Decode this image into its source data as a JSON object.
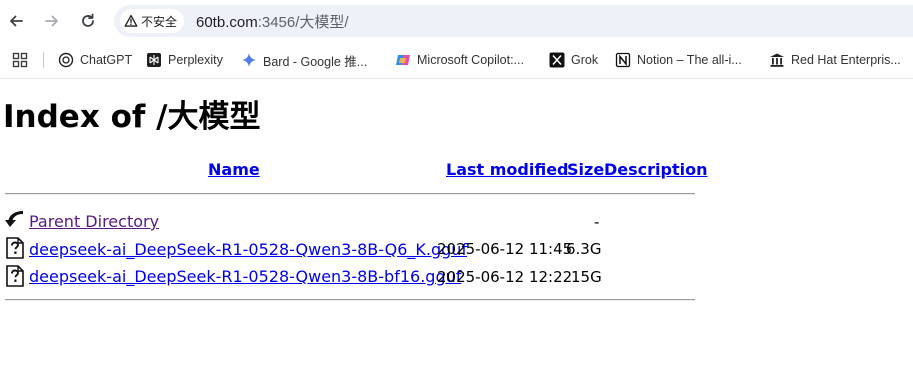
{
  "browser": {
    "security_chip": "不安全",
    "url_host": "60tb.com",
    "url_path": ":3456/大模型/"
  },
  "bookmarks": [
    {
      "label": "ChatGPT",
      "icon": "chatgpt-icon"
    },
    {
      "label": "Perplexity",
      "icon": "perplexity-icon"
    },
    {
      "label": "Bard - Google 推...",
      "icon": "bard-sparkle-icon"
    },
    {
      "label": "Microsoft Copilot:...",
      "icon": "copilot-icon"
    },
    {
      "label": "Grok",
      "icon": "x-icon"
    },
    {
      "label": "Notion – The all-i...",
      "icon": "notion-icon"
    },
    {
      "label": "Red Hat Enterpris...",
      "icon": "building-icon"
    }
  ],
  "page": {
    "title": "Index of /大模型",
    "columns": {
      "name": "Name",
      "last_modified": "Last modified",
      "size": "Size",
      "description": "Description"
    },
    "parent": {
      "label": "Parent Directory",
      "size": "-"
    },
    "files": [
      {
        "name": "deepseek-ai_DeepSeek-R1-0528-Qwen3-8B-Q6_K.gguf",
        "modified": "2025-06-12 11:45",
        "size": "6.3G",
        "icon": "unknown-file-icon"
      },
      {
        "name": "deepseek-ai_DeepSeek-R1-0528-Qwen3-8B-bf16.gguf",
        "modified": "2025-06-12 12:22",
        "size": "15G",
        "icon": "unknown-file-icon"
      }
    ]
  }
}
